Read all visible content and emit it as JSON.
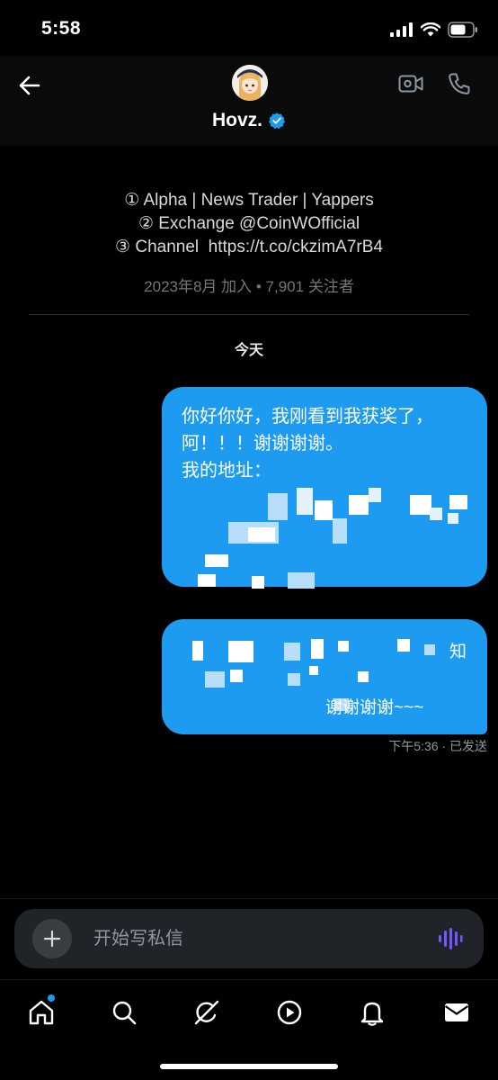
{
  "status_bar": {
    "time": "5:58"
  },
  "header": {
    "name": "Hovz."
  },
  "bio": {
    "lines": [
      "① Alpha | News Trader | Yappers",
      "② Exchange @CoinWOfficial",
      "③ Channel  https://t.co/ckzimA7rB4"
    ],
    "meta": "2023年8月 加入 • 7,901 关注者"
  },
  "date_separator": "今天",
  "messages": [
    {
      "lines": [
        "你好你好，我刚看到我获奖了，",
        "阿！！！谢谢谢谢。",
        "",
        "我的地址："
      ]
    },
    {
      "fragments": [
        "知",
        "谢谢谢谢~~~"
      ]
    }
  ],
  "message_meta": "下午5:36 · 已发送",
  "composer": {
    "placeholder": "开始写私信"
  },
  "colors": {
    "accent": "#1d9bf0",
    "background": "#000000",
    "composer_bg": "#202327",
    "voice_icon": "#7856ff"
  },
  "tabs": [
    "home-icon",
    "search-icon",
    "grok-icon",
    "video-icon",
    "notifications-icon",
    "messages-icon"
  ]
}
